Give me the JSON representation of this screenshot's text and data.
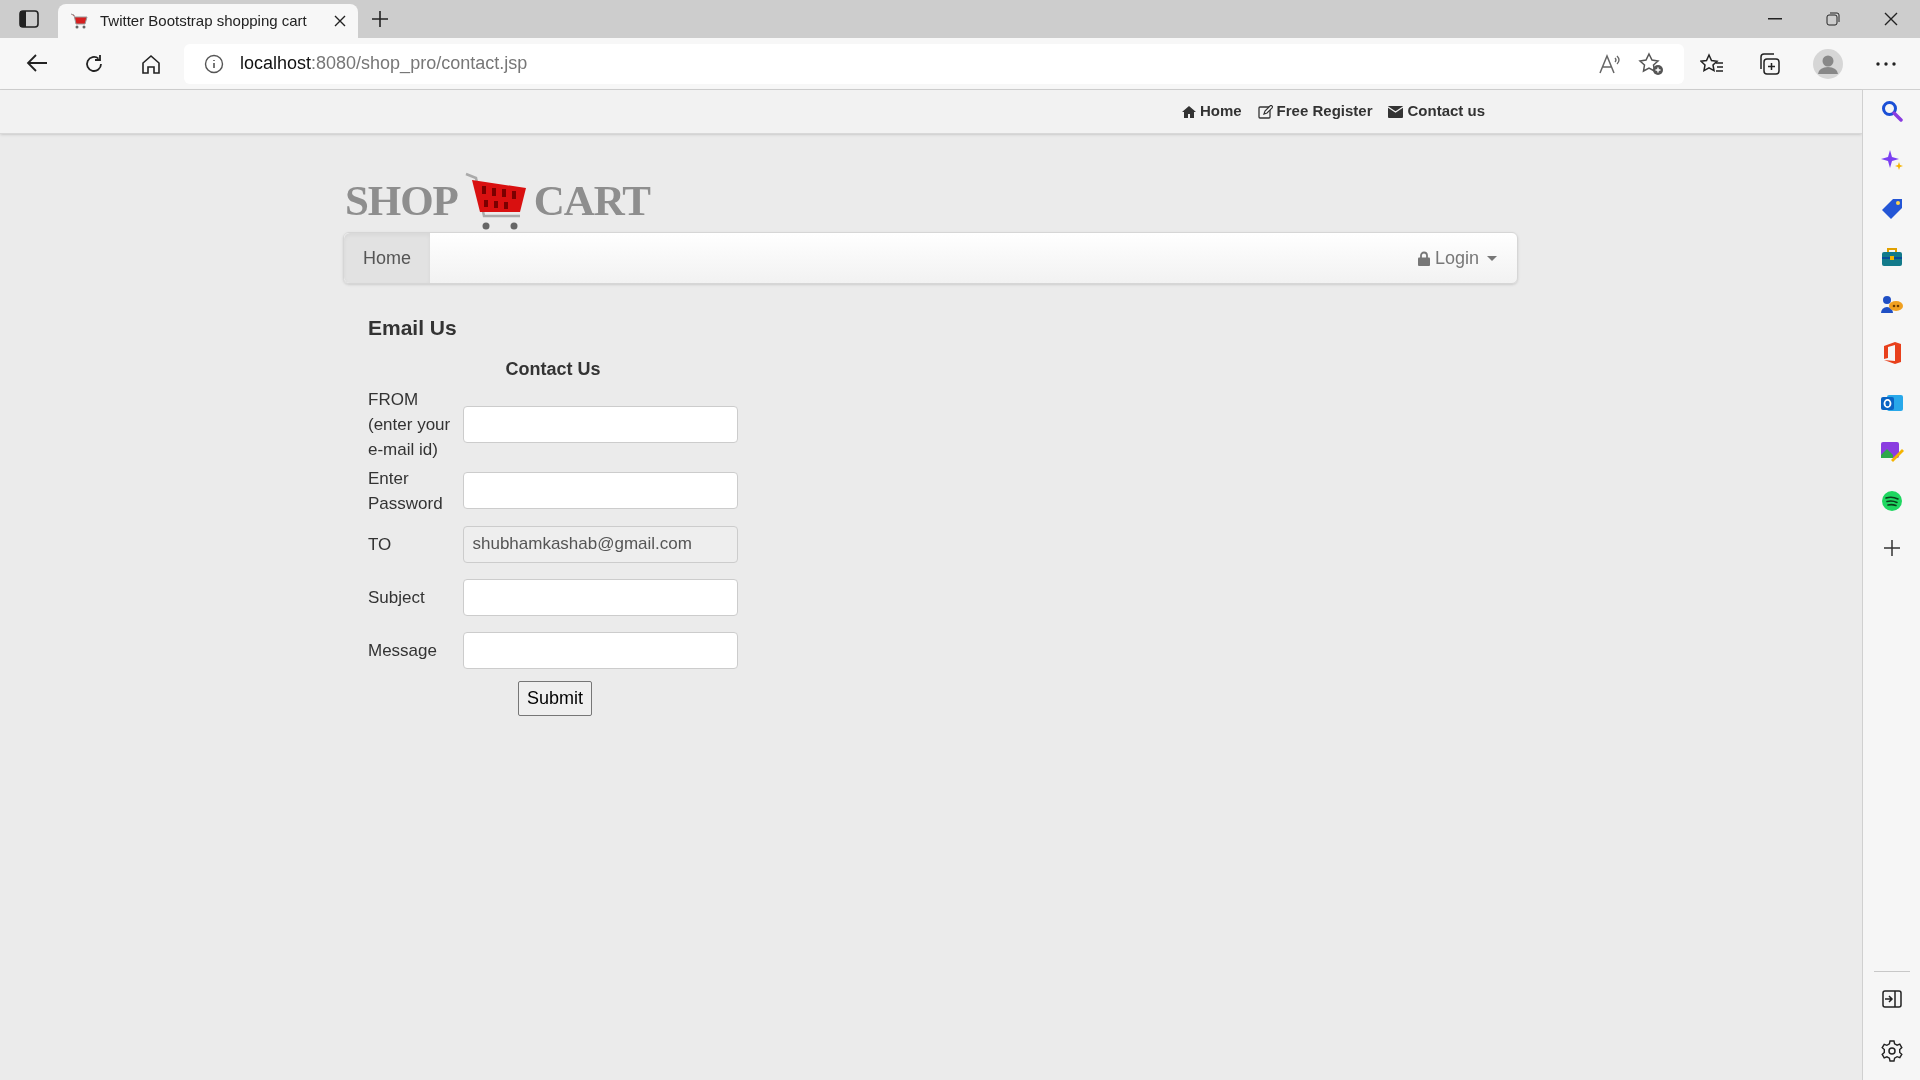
{
  "browser": {
    "tab": {
      "title": "Twitter Bootstrap shopping cart",
      "selected": true
    },
    "address": {
      "host": "localhost",
      "path": ":8080/shop_pro/contact.jsp"
    }
  },
  "top_links": [
    {
      "kind": "home",
      "label": "Home"
    },
    {
      "kind": "register",
      "label": "Free Register"
    },
    {
      "kind": "contact",
      "label": "Contact us"
    }
  ],
  "logo": {
    "left": "SHOP",
    "right": "CART"
  },
  "navbar": {
    "items": [
      {
        "label": "Home",
        "selected": true
      }
    ],
    "login": "Login"
  },
  "heading": "Email Us",
  "form": {
    "title": "Contact Us",
    "fields": [
      {
        "label": "FROM (enter your e-mail id)",
        "readonly": false
      },
      {
        "label": "Enter Password",
        "readonly": false
      },
      {
        "label": "TO",
        "value": "shubhamkashab@gmail.com",
        "readonly": true
      },
      {
        "label": "Subject",
        "readonly": false
      },
      {
        "label": "Message",
        "readonly": false
      }
    ],
    "submit": "Submit"
  }
}
